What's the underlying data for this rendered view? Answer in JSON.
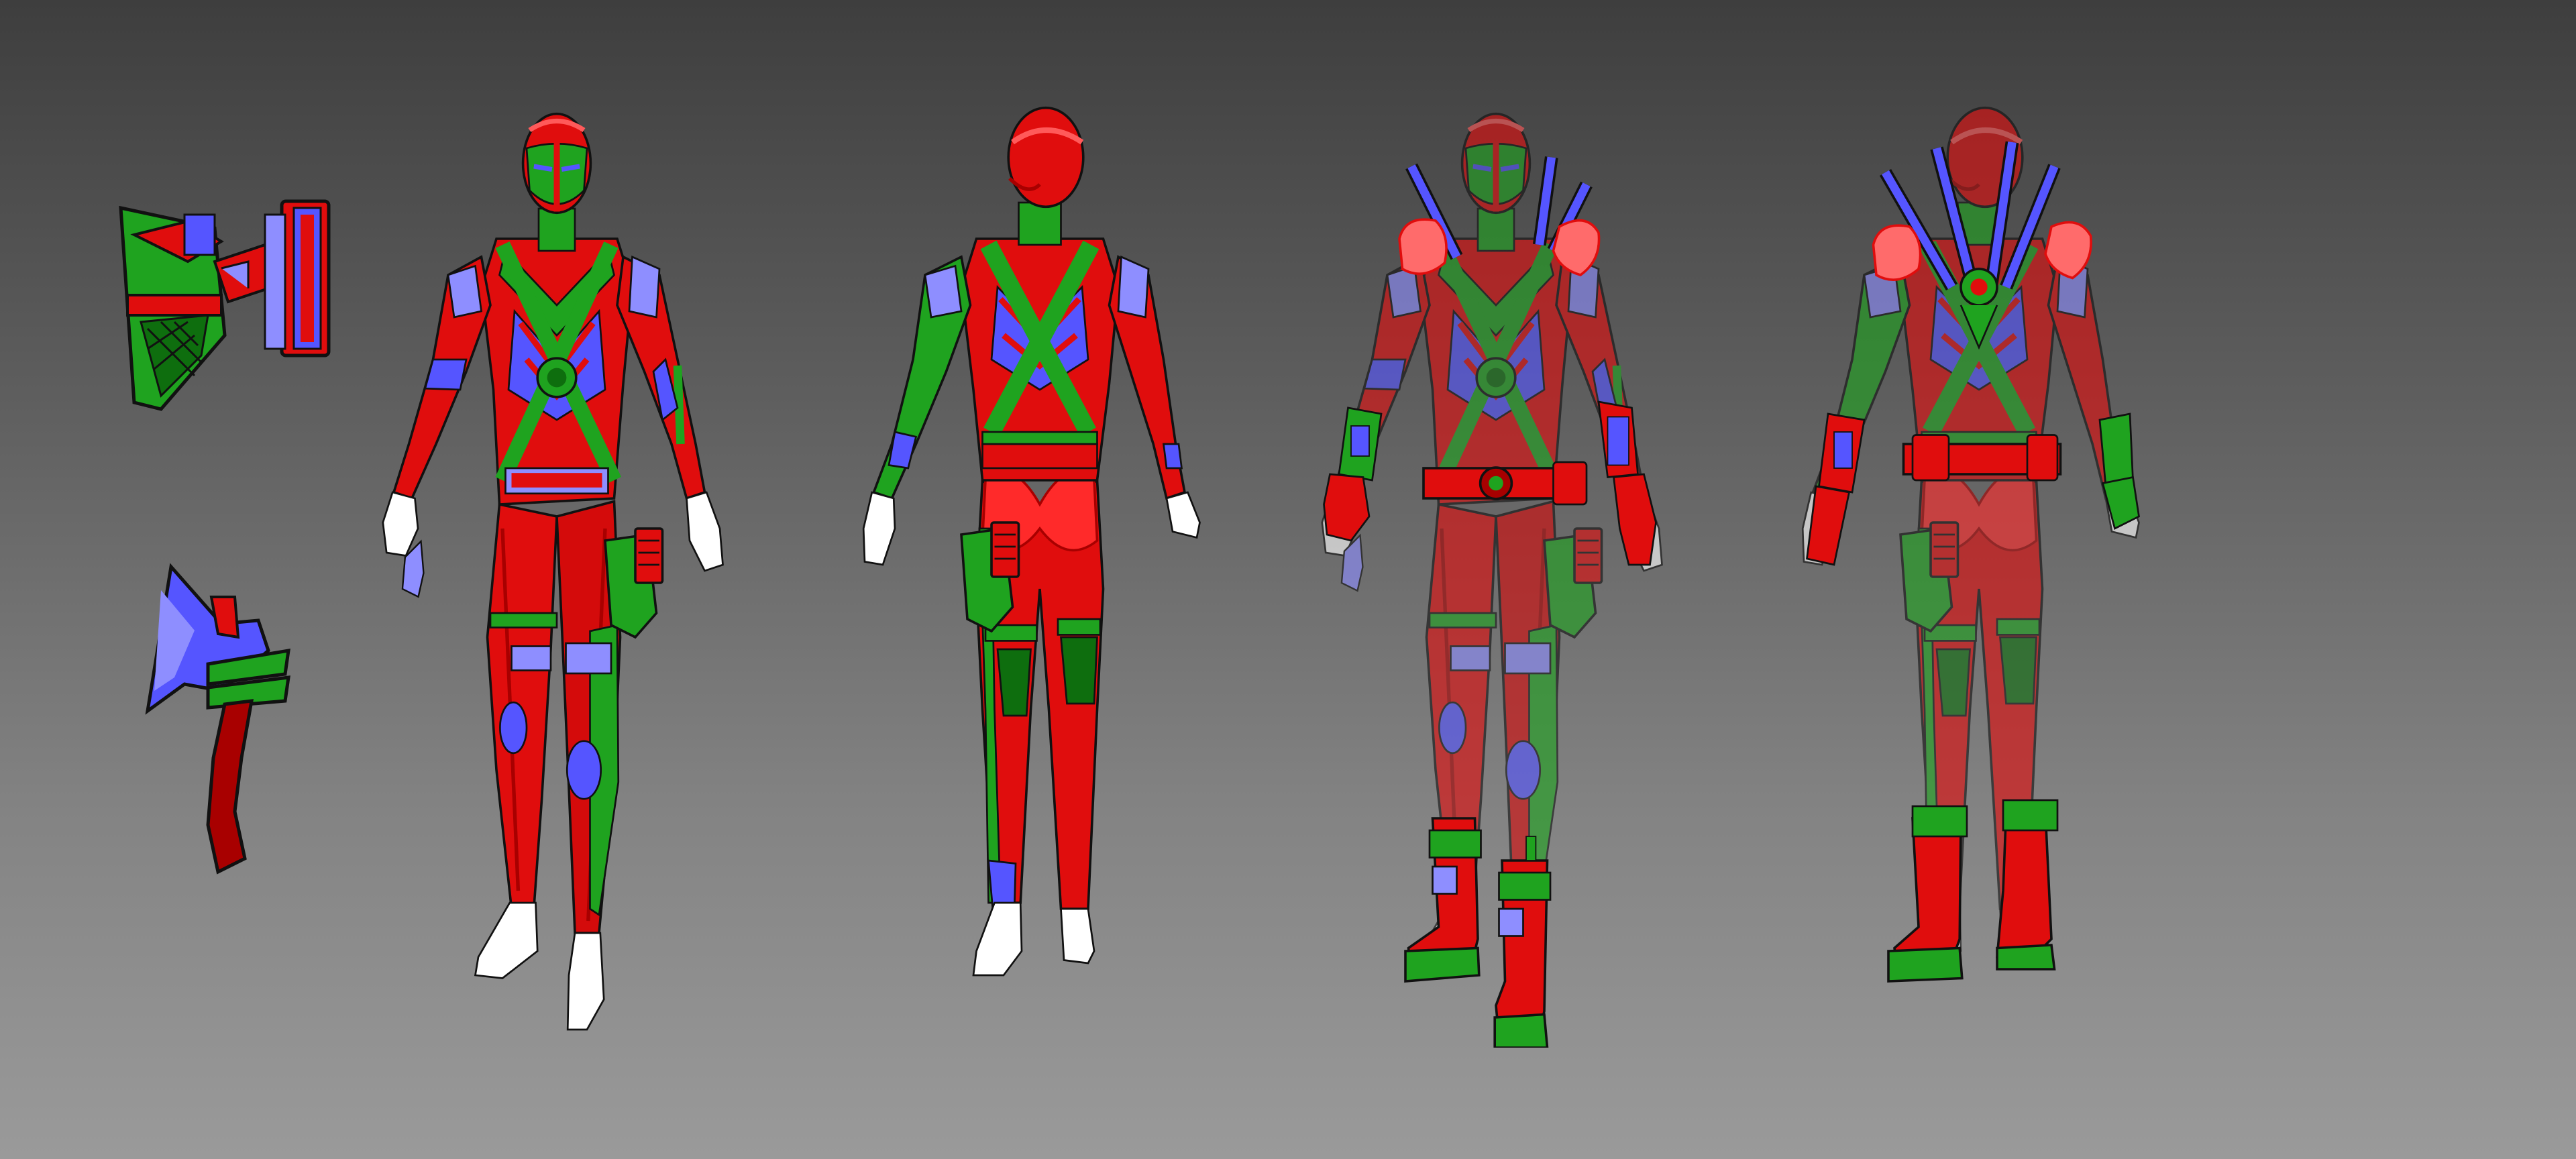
{
  "sheet": {
    "kind": "color-id material map turnaround",
    "colors": {
      "red": "#e00d0d",
      "dark_red": "#a80000",
      "green": "#1fa31f",
      "dark_green": "#0e6e0e",
      "blue": "#5555ff",
      "light_blue": "#8e8eff",
      "white": "#ffffff",
      "outline": "#111111"
    },
    "props": [
      {
        "name": "holster",
        "icon": "holster-icon"
      },
      {
        "name": "hatchet",
        "icon": "axe-icon"
      }
    ],
    "views": [
      {
        "name": "base-front",
        "icon": "figure-front-icon",
        "overlay": false
      },
      {
        "name": "base-back",
        "icon": "figure-back-icon",
        "overlay": false
      },
      {
        "name": "gear-front",
        "icon": "figure-front-icon",
        "overlay": true
      },
      {
        "name": "gear-back",
        "icon": "figure-back-icon",
        "overlay": true
      }
    ]
  }
}
